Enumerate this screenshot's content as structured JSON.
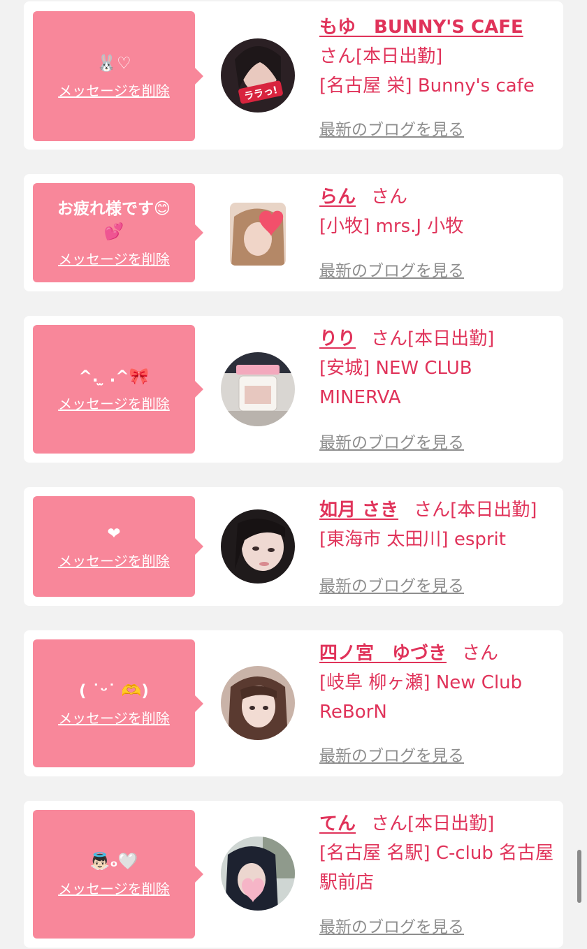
{
  "colors": {
    "accent": "#e0335a",
    "bubble": "#f8879a",
    "card": "#ffffff",
    "background": "#f2f2f2",
    "muted": "#8e8e8e"
  },
  "items": [
    {
      "message": "🐰♡",
      "delete_label": "メッセージを削除",
      "name": "もゆ　BUNNY'S CAFE",
      "suffix": "さん[本日出勤]",
      "shop": "[名古屋 栄] Bunny's cafe",
      "blog_label": "最新のブログを見る",
      "avatar_icon": "avatar-photo",
      "avatar_sticker": "ララっ!"
    },
    {
      "message": "お疲れ様です😊\n💕",
      "delete_label": "メッセージを削除",
      "name": "らん",
      "suffix": "さん",
      "shop": "[小牧] mrs.J 小牧",
      "blog_label": "最新のブログを見る",
      "avatar_icon": "avatar-photo"
    },
    {
      "message": "^. ̫ .^🎀",
      "delete_label": "メッセージを削除",
      "name": "りり",
      "suffix": "さん[本日出勤]",
      "shop": "[安城] NEW CLUB MINERVA",
      "blog_label": "最新のブログを見る",
      "avatar_icon": "avatar-photo"
    },
    {
      "message": "❤",
      "delete_label": "メッセージを削除",
      "name": "如月 さき",
      "suffix": "さん[本日出勤]",
      "shop": "[東海市 太田川] esprit",
      "blog_label": "最新のブログを見る",
      "avatar_icon": "avatar-photo"
    },
    {
      "message": "( ˙ᵕ˙ 🫶)",
      "delete_label": "メッセージを削除",
      "name": "四ノ宮　ゆづき",
      "suffix": "さん",
      "shop": "[岐阜 柳ヶ瀬] New Club ReBorN",
      "blog_label": "最新のブログを見る",
      "avatar_icon": "avatar-photo"
    },
    {
      "message": "👼🏻ₒ🤍",
      "delete_label": "メッセージを削除",
      "name": "てん",
      "suffix": "さん[本日出勤]",
      "shop": "[名古屋 名駅] C-club 名古屋駅前店",
      "blog_label": "最新のブログを見る",
      "avatar_icon": "avatar-photo"
    }
  ]
}
